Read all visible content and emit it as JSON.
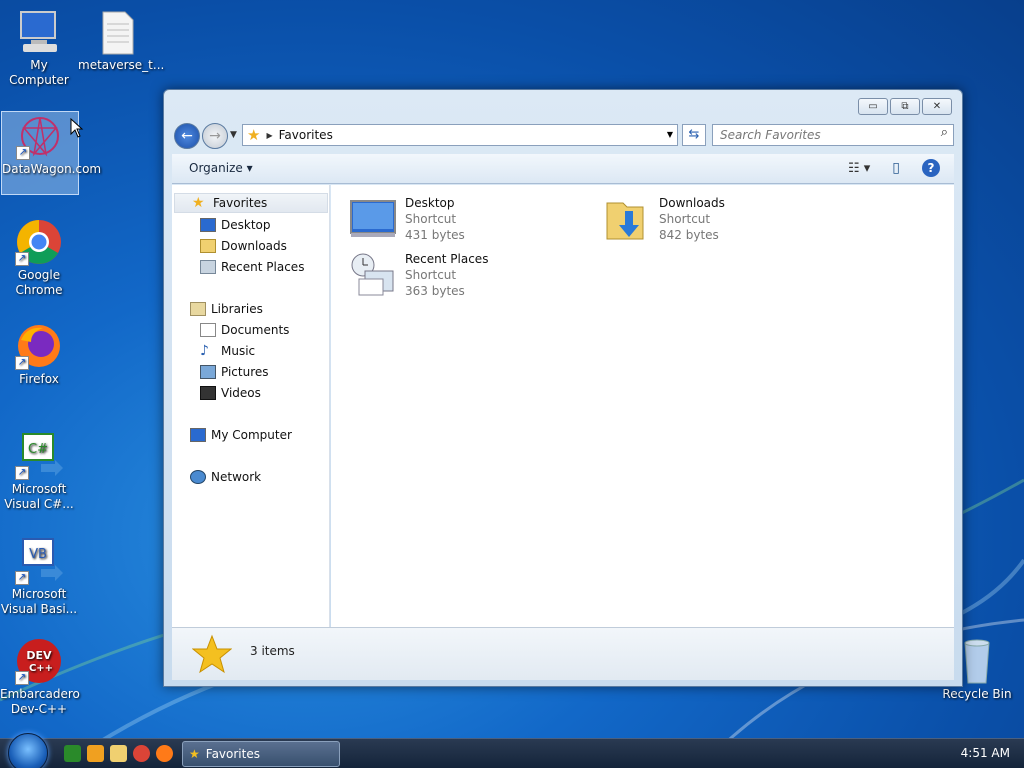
{
  "desktop": {
    "icons": [
      {
        "label": "My Computer",
        "icon": "computer-icon"
      },
      {
        "label": "metaverse_t...",
        "icon": "text-file-icon"
      },
      {
        "label": "DataWagon.com",
        "icon": "datawagon-icon"
      },
      {
        "label": "Google Chrome",
        "icon": "chrome-icon"
      },
      {
        "label": "Firefox",
        "icon": "firefox-icon"
      },
      {
        "label": "Microsoft Visual C#...",
        "icon": "visual-csharp-icon"
      },
      {
        "label": "Microsoft Visual Basi...",
        "icon": "visual-basic-icon"
      },
      {
        "label": "Embarcadero Dev-C++",
        "icon": "devcpp-icon"
      },
      {
        "label": "Recycle Bin",
        "icon": "recycle-bin-icon"
      }
    ],
    "icon_glyphs": {
      "csharp": "C#",
      "vb": "VB",
      "dev": "DEV",
      "cpp": "C++"
    }
  },
  "window": {
    "controls": {
      "minimize": "▭",
      "restore": "⧉",
      "close": "✕"
    },
    "address": {
      "crumb": "Favorites"
    },
    "search": {
      "placeholder": "Search Favorites"
    },
    "toolbar": {
      "organize": "Organize ▾"
    },
    "nav_pane": {
      "favorites": "Favorites",
      "favorites_items": [
        "Desktop",
        "Downloads",
        "Recent Places"
      ],
      "libraries": "Libraries",
      "libraries_items": [
        "Documents",
        "Music",
        "Pictures",
        "Videos"
      ],
      "my_computer": "My Computer",
      "network": "Network"
    },
    "files": [
      {
        "name": "Desktop",
        "type": "Shortcut",
        "size": "431 bytes"
      },
      {
        "name": "Downloads",
        "type": "Shortcut",
        "size": "842 bytes"
      },
      {
        "name": "Recent Places",
        "type": "Shortcut",
        "size": "363 bytes"
      }
    ],
    "status": {
      "count": "3 items"
    }
  },
  "taskbar": {
    "task_label": "Favorites",
    "clock": "4:51 AM"
  },
  "colors": {
    "accent": "#1c4fa8",
    "selection": "#cce4f8"
  }
}
